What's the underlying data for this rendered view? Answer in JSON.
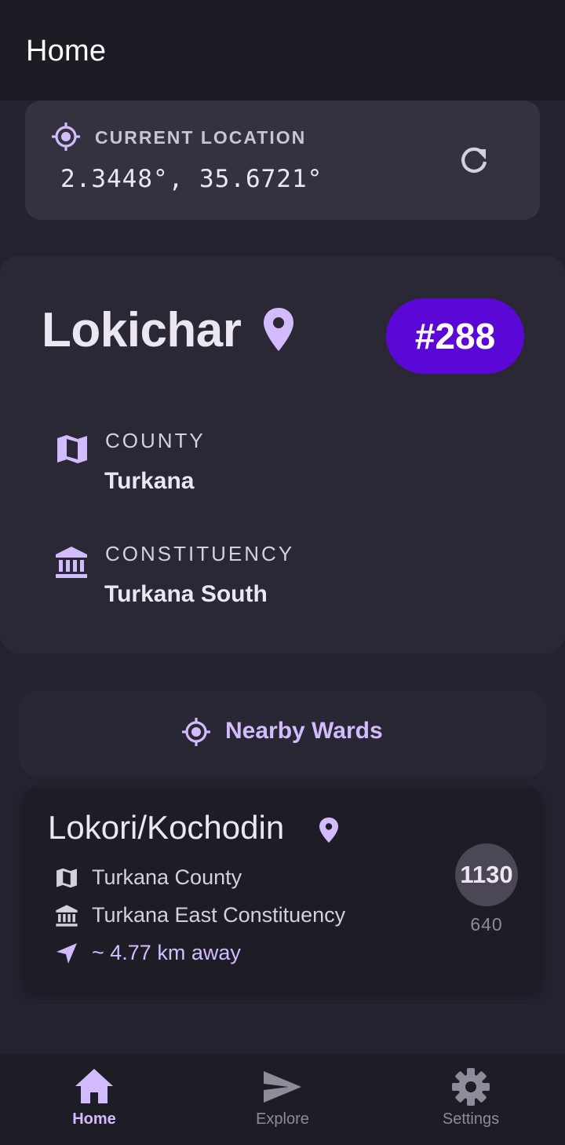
{
  "topbar": {
    "title": "Home"
  },
  "current_location": {
    "label": "CURRENT LOCATION",
    "coordinates": "2.3448°, 35.6721°",
    "icon": "gps-target-icon",
    "refresh_icon": "refresh-icon"
  },
  "ward": {
    "name": "Lokichar",
    "number": "#288",
    "county_label": "COUNTY",
    "county_value": "Turkana",
    "constituency_label": "CONSTITUENCY",
    "constituency_value": "Turkana South"
  },
  "nearby_button": {
    "label": "Nearby Wards"
  },
  "nearby_wards": [
    {
      "name": "Lokori/Kochodin",
      "county": "Turkana County",
      "constituency": "Turkana East Constituency",
      "distance": "~ 4.77 km away",
      "number": "1130",
      "sub_number": "640"
    }
  ],
  "bottom_nav": [
    {
      "label": "Home",
      "icon": "home-icon",
      "active": true
    },
    {
      "label": "Explore",
      "icon": "send-icon",
      "active": false
    },
    {
      "label": "Settings",
      "icon": "gear-icon",
      "active": false
    }
  ],
  "colors": {
    "accent": "#d2bcff",
    "badge": "#5b08d6",
    "background": "#252230",
    "card": "#35323f"
  }
}
